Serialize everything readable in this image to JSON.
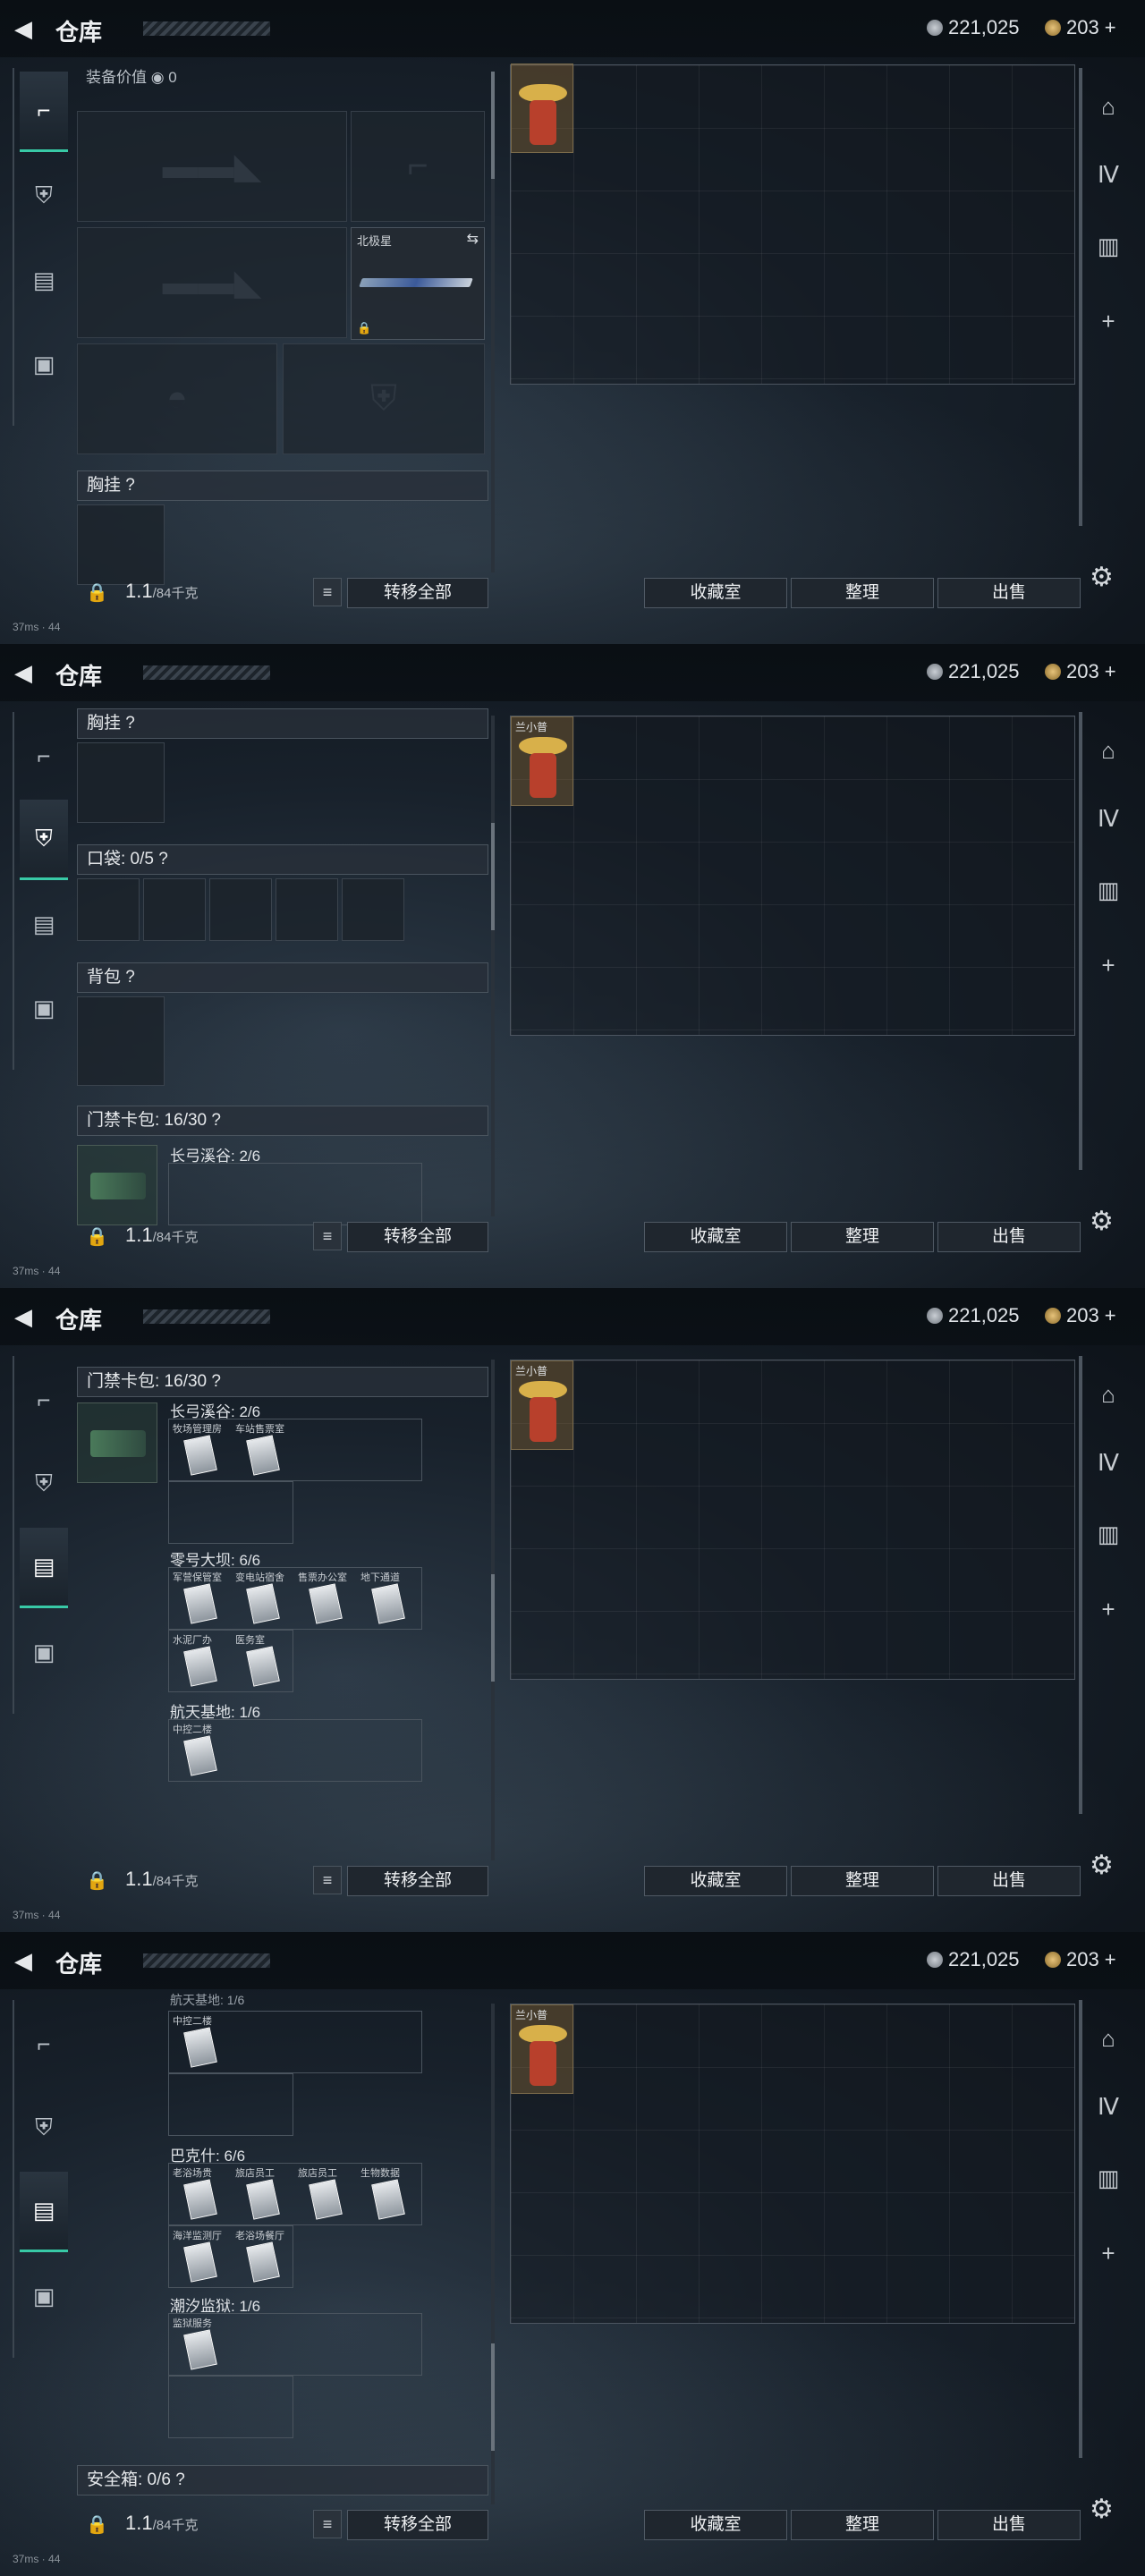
{
  "header": {
    "title": "仓库",
    "currency1": "221,025",
    "currency2": "203",
    "currency2_plus": "+"
  },
  "bottom": {
    "weight": "1.1",
    "weight_max": "/84千克",
    "transfer_all": "转移全部",
    "collection": "收藏室",
    "sort": "整理",
    "sell": "出售"
  },
  "status": {
    "ping": "37ms",
    "num": "44"
  },
  "equip": {
    "value_label": "装备价值",
    "value": "0",
    "knife_name": "北极星"
  },
  "sections": {
    "chest": "胸挂",
    "pockets": "口袋: 0/5",
    "backpack": "背包",
    "keycard": "门禁卡包: 16/30",
    "safe": "安全箱: 0/6"
  },
  "help": "?",
  "stash_item_label": "兰小普",
  "keycards": {
    "longbow": {
      "title": "长弓溪谷: 2/6",
      "cards": [
        "牧场管理房",
        "车站售票室"
      ]
    },
    "dam": {
      "title": "零号大坝: 6/6",
      "cards": [
        "军营保管室",
        "变电站宿舍",
        "售票办公室",
        "地下通道",
        "水泥厂办",
        "医务室"
      ]
    },
    "space": {
      "title": "航天基地: 1/6",
      "cards": [
        "中控二楼"
      ]
    },
    "baks": {
      "title": "巴克什: 6/6",
      "cards": [
        "老浴场贵",
        "旅店员工",
        "旅店员工",
        "生物数据",
        "海洋监测厅",
        "老浴场餐厅"
      ]
    },
    "tide": {
      "title": "潮汐监狱: 1/6",
      "cards": [
        "监狱服务"
      ]
    },
    "space_partial": "航天基地: 1/6"
  },
  "icons": [
    "back-icon",
    "pistol-icon",
    "armor-icon",
    "backpack-icon",
    "briefcase-icon",
    "lock-icon",
    "list-icon",
    "gear-icon",
    "swap-icon"
  ]
}
